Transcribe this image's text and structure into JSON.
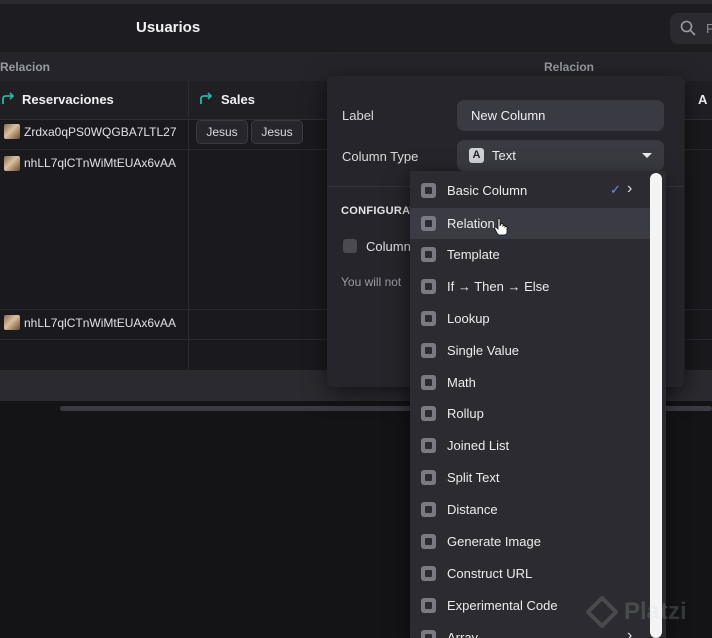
{
  "topbar": {
    "title": "Usuarios",
    "search_placeholder": "F"
  },
  "grid": {
    "group_headers": [
      "Relacion",
      "Relacion"
    ],
    "columns": [
      "Reservaciones",
      "Sales",
      "A"
    ],
    "rows": [
      {
        "value": "Zrdxa0qPS0WQGBA7LTL27"
      },
      {
        "value": "nhLL7qlCTnWiMtEUAx6vAA"
      },
      {
        "value": "nhLL7qlCTnWiMtEUAx6vAA"
      }
    ],
    "sales_chips": [
      "Jesus",
      "Jesus"
    ]
  },
  "panel": {
    "label_label": "Label",
    "label_value": "New Column",
    "type_label": "Column Type",
    "type_value": "Text",
    "type_icon": "A",
    "section_title": "CONFIGURAT",
    "checkbox_label": "Column",
    "note": "You will not"
  },
  "menu": {
    "items": [
      {
        "label": "Basic Column",
        "icon": "text-a-icon"
      },
      {
        "label": "Relation",
        "icon": "relation-icon"
      },
      {
        "label": "Template",
        "icon": "template-icon"
      },
      {
        "label": "If → Then → Else",
        "icon": "if-then-else-icon"
      },
      {
        "label": "Lookup",
        "icon": "lookup-icon"
      },
      {
        "label": "Single Value",
        "icon": "single-value-icon"
      },
      {
        "label": "Math",
        "icon": "math-icon"
      },
      {
        "label": "Rollup",
        "icon": "rollup-icon"
      },
      {
        "label": "Joined List",
        "icon": "joined-list-icon"
      },
      {
        "label": "Split Text",
        "icon": "split-text-icon"
      },
      {
        "label": "Distance",
        "icon": "distance-icon"
      },
      {
        "label": "Generate Image",
        "icon": "generate-image-icon"
      },
      {
        "label": "Construct URL",
        "icon": "link-icon"
      },
      {
        "label": "Experimental Code",
        "icon": "code-icon"
      },
      {
        "label": "Array",
        "icon": "array-icon"
      }
    ],
    "selected": "Basic Column",
    "hovered": "Relation",
    "check_glyph": "✓",
    "chevron_glyph": "›"
  },
  "watermark": {
    "text": "Platzi"
  },
  "colors": {
    "accent": "#6f8cff",
    "relation_arrow": "#2bb3a0",
    "panel_bg": "#25252b",
    "menu_bg": "#2b2b31"
  }
}
